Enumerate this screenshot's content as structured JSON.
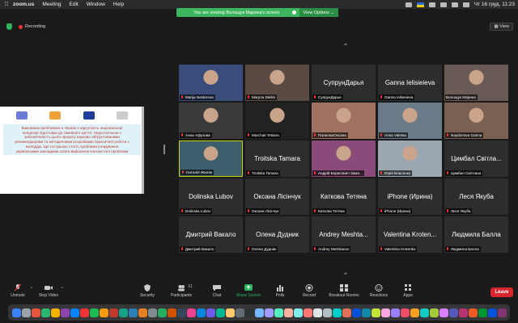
{
  "menubar": {
    "app_name": "zoom.us",
    "items": [
      "Meeting",
      "Edit",
      "Window",
      "Help"
    ],
    "clock": "Чт 16 груд.  11:23"
  },
  "banner": {
    "text": "You are viewing Волощук Марина's screen",
    "options_label": "View Options ⌄"
  },
  "topbar": {
    "recording_label": "Recording",
    "view_label": "▦ View"
  },
  "share": {
    "text": "Важливою проблемою в Україні є відсутність національної концепції підготовки до сімейного життя. Недостатньою є забезпеченість цього процесу науково обґрунтованими рекомендаціями та методичними розробками практичної роботи з молоддю. Ще гострішою стоїть проблема ігнорування українськими закладами освіти вирішення контекстної проблеми"
  },
  "participants": [
    {
      "name": "Marija Nesterova",
      "big": "",
      "photo": "#3a4d7a",
      "muted": true
    },
    {
      "name": "Maryna Dielini",
      "big": "",
      "photo": "#5a4a44",
      "muted": true
    },
    {
      "name": "СупрунДарья",
      "big": "СупрунДарья",
      "photo": "",
      "muted": true
    },
    {
      "name": "Ganna Ielisieieva",
      "big": "Ganna Ielisieieva",
      "photo": "",
      "muted": true
    },
    {
      "name": "Волощук Марина",
      "big": "",
      "photo": "#6a5a55",
      "muted": false
    },
    {
      "name": "Анна Афузова",
      "big": "",
      "photo": "#3a3a3a",
      "muted": true
    },
    {
      "name": "Marchak Tetiana",
      "big": "",
      "photo": "#222222",
      "muted": true
    },
    {
      "name": "ПалилюкОксана",
      "big": "",
      "photo": "#a07060",
      "muted": true
    },
    {
      "name": "Anna Valetsa",
      "big": "",
      "photo": "#6a7a88",
      "muted": true
    },
    {
      "name": "Naydonova Ganna",
      "big": "",
      "photo": "#7a6050",
      "muted": true
    },
    {
      "name": "Наталія Жиляк",
      "big": "",
      "photo": "#3e5e6e",
      "muted": true
    },
    {
      "name": "Troitska Tamara",
      "big": "Troitska Tamara",
      "photo": "",
      "muted": true
    },
    {
      "name": "Андрій Борисович Замо...",
      "big": "",
      "photo": "#8a4a7a",
      "muted": true
    },
    {
      "name": "Юрій Власенко",
      "big": "",
      "photo": "#9aa6b0",
      "muted": true
    },
    {
      "name": "Цимбал Світлана",
      "big": "Цимбал Світла...",
      "photo": "",
      "muted": true
    },
    {
      "name": "Dolinska Lubov",
      "big": "Dolinska Lubov",
      "photo": "",
      "muted": true
    },
    {
      "name": "Оксана Лісінчук",
      "big": "Оксана Лісінчук",
      "photo": "",
      "muted": true
    },
    {
      "name": "Каткова Тетяна",
      "big": "Каткова Тетяна",
      "photo": "",
      "muted": true
    },
    {
      "name": "iPhone (Ирина)",
      "big": "iPhone (Ирина)",
      "photo": "",
      "muted": true
    },
    {
      "name": "Леся Якуба",
      "big": "Леся Якуба",
      "photo": "",
      "muted": true
    },
    {
      "name": "Дмитрий Вакало",
      "big": "Дмитрий Вакало",
      "photo": "",
      "muted": true
    },
    {
      "name": "Олена Дудник",
      "big": "Олена Дудник",
      "photo": "",
      "muted": true
    },
    {
      "name": "Andrey Meshtanov",
      "big": "Andrey Meshta...",
      "photo": "",
      "muted": true
    },
    {
      "name": "Valentina Krotenko",
      "big": "Valentina Kroten...",
      "photo": "",
      "muted": true
    },
    {
      "name": "Людмила Балла",
      "big": "Людмила Балла",
      "photo": "",
      "muted": true
    }
  ],
  "toolbar": {
    "unmute": "Unmute",
    "stop_video": "Stop Video",
    "security": "Security",
    "participants": "Participants",
    "participants_count": "61",
    "chat": "Chat",
    "share_screen": "Share Screen",
    "polls": "Polls",
    "record": "Record",
    "breakout_rooms": "Breakout Rooms",
    "reactions": "Reactions",
    "apps": "Apps",
    "leave": "Leave"
  },
  "colors": {
    "banner_green": "#3db55e",
    "leave_red": "#d8262e",
    "active_speaker": "#c7d400",
    "share_green": "#2db45d"
  },
  "dock_colors": [
    "#3b82f6",
    "#9aa3ad",
    "#e8543b",
    "#2bb673",
    "#f4b400",
    "#8e44ad",
    "#0b84ff",
    "#e33",
    "#1db954",
    "#f39c12",
    "#c0392b",
    "#16a085",
    "#2980b9",
    "#e67e22",
    "#7f8c8d",
    "#27ae60",
    "#d35400",
    "#34495e",
    "#e84393",
    "#0984e3",
    "#6c5ce7",
    "#00b894",
    "#fdcb6e",
    "#636e72",
    "#2d3436",
    "#74b9ff",
    "#a29bfe",
    "#55efc4",
    "#fab1a0",
    "#81ecec",
    "#ff7675",
    "#dfe6e9",
    "#b2bec3",
    "#00cec9",
    "#e17055",
    "#0652dd",
    "#1289a7",
    "#c4e538",
    "#fda7df",
    "#9980fa",
    "#ed4c67",
    "#f79f1f",
    "#12cbc4",
    "#a3cb38",
    "#d980fa",
    "#5758bb",
    "#b53471",
    "#ee5a24",
    "#009432",
    "#0652dd",
    "#833471"
  ]
}
